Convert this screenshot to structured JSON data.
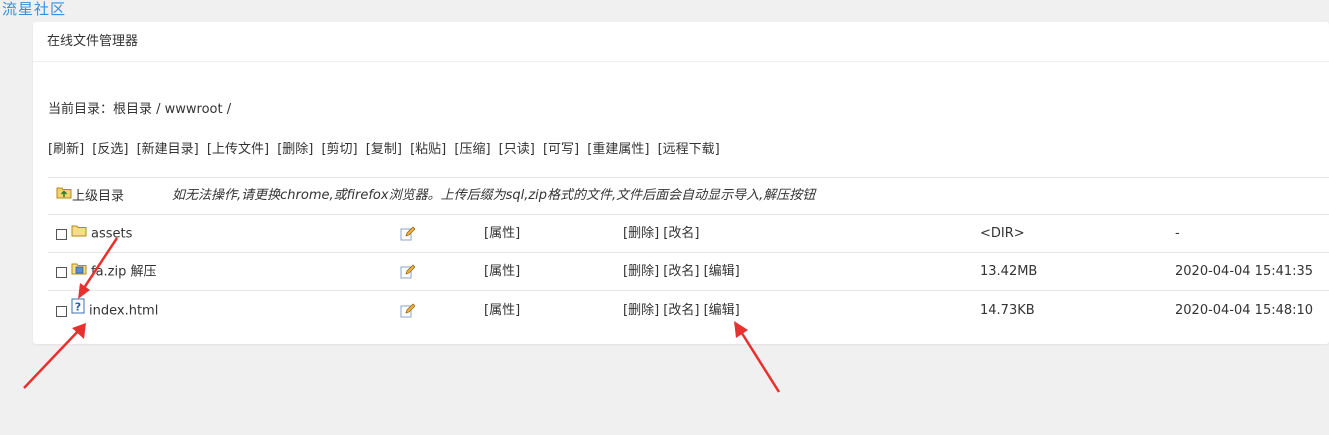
{
  "watermark": "流星社区",
  "panel": {
    "title": "在线文件管理器"
  },
  "path": {
    "text": "当前目录：根目录 / wwwroot /"
  },
  "actions": [
    "[刷新]",
    "[反选]",
    "[新建目录]",
    "[上传文件]",
    "[删除]",
    "[剪切]",
    "[复制]",
    "[粘贴]",
    "[压缩]",
    "[只读]",
    "[可写]",
    "[重建属性]",
    "[远程下载]"
  ],
  "parent": {
    "label": "上级目录",
    "note": "如无法操作,请更换chrome,或firefox浏览器。上传后缀为sql,zip格式的文件,文件后面会自动显示导入,解压按钮"
  },
  "files": [
    {
      "name": "assets",
      "icon": "folder-icon",
      "prop": "[属性]",
      "ops": [
        "[删除]",
        "[改名]"
      ],
      "size": "<DIR>",
      "time": "-"
    },
    {
      "name": "fa.zip 解压",
      "icon": "zip-icon",
      "prop": "[属性]",
      "ops": [
        "[删除]",
        "[改名]",
        "[编辑]"
      ],
      "size": "13.42MB",
      "time": "2020-04-04 15:41:35"
    },
    {
      "name": "index.html",
      "icon": "unknown-file-icon",
      "prop": "[属性]",
      "ops": [
        "[删除]",
        "[改名]",
        "[编辑]"
      ],
      "size": "14.73KB",
      "time": "2020-04-04 15:48:10"
    }
  ],
  "colors": {
    "arrow": "#e8312f",
    "watermark": "#3a8fd6",
    "background": "#f0f0f0"
  }
}
